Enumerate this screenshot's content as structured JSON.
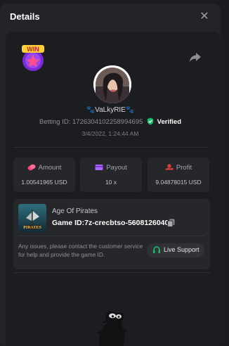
{
  "modal": {
    "title": "Details"
  },
  "header": {
    "close_glyph": "✕"
  },
  "badge": {
    "text": "WIN"
  },
  "user": {
    "name": "🐾VaLkyRIE🐾",
    "betting_id_label": "Betting ID:",
    "betting_id": "1726304102258994695",
    "verified_label": "Verified",
    "datetime": "3/4/2022, 1:24:44 AM"
  },
  "stats": {
    "amount": {
      "label": "Amount",
      "value": "1.00541965 USD"
    },
    "payout": {
      "label": "Payout",
      "value": "10 x"
    },
    "profit": {
      "label": "Profit",
      "value": "9.04878015 USD"
    }
  },
  "game": {
    "name": "Age Of Pirates",
    "thumb_text": "PIRATES",
    "id_label": "Game ID:",
    "id": "7z-crecbtso-5608126040",
    "help_text": "Any issues, please contact the customer service for help and provide the game ID.",
    "support_label": "Live Support"
  },
  "colors": {
    "accent_green": "#16c266",
    "verified_green": "#16c266",
    "amount_icon": "#f0477a",
    "payout_icon": "#a966ff",
    "profit_icon": "#e23d3d"
  },
  "icons": {
    "close": "close-icon",
    "share": "share-icon",
    "verified": "verified-check-icon",
    "amount": "coins-icon",
    "payout": "card-icon",
    "profit": "hand-coin-icon",
    "copy": "copy-icon",
    "support": "headset-icon"
  }
}
